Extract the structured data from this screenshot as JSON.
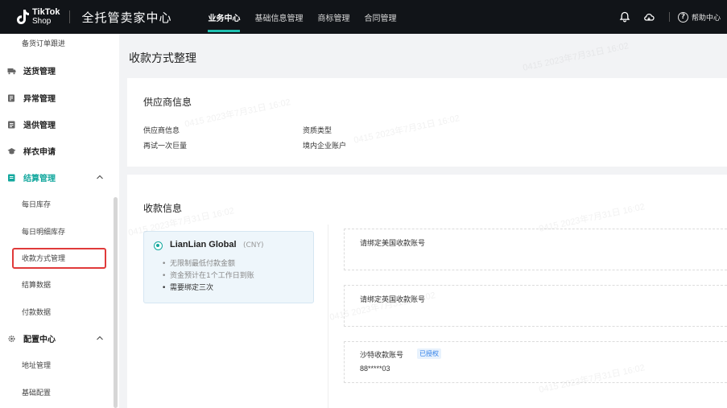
{
  "header": {
    "logo_line1": "TikTok",
    "logo_line2": "Shop",
    "app_title": "全托管卖家中心",
    "nav": [
      {
        "label": "业务中心",
        "active": true
      },
      {
        "label": "基础信息管理",
        "active": false
      },
      {
        "label": "商标管理",
        "active": false
      },
      {
        "label": "合同管理",
        "active": false
      }
    ],
    "help_label": "帮助中心",
    "help_icon": "?",
    "icons": [
      "bell-icon",
      "cloud-icon",
      "help-icon"
    ]
  },
  "sidebar": {
    "items": [
      {
        "label": "备货订单跟进",
        "type": "sub"
      },
      {
        "label": "送货管理",
        "type": "group",
        "icon": "truck-icon"
      },
      {
        "label": "异常管理",
        "type": "group",
        "icon": "warning-doc-icon"
      },
      {
        "label": "退供管理",
        "type": "group",
        "icon": "return-icon"
      },
      {
        "label": "样衣申请",
        "type": "group",
        "icon": "hat-icon"
      },
      {
        "label": "结算管理",
        "type": "group",
        "icon": "settlement-icon",
        "expanded": true
      },
      {
        "label": "每日库存",
        "type": "sub"
      },
      {
        "label": "每日明细库存",
        "type": "sub"
      },
      {
        "label": "收款方式管理",
        "type": "sub",
        "selected": true
      },
      {
        "label": "结算数据",
        "type": "sub"
      },
      {
        "label": "付款数据",
        "type": "sub"
      },
      {
        "label": "配置中心",
        "type": "group",
        "icon": "gear-icon",
        "expanded": true
      },
      {
        "label": "地址管理",
        "type": "sub"
      },
      {
        "label": "基础配置",
        "type": "sub"
      }
    ]
  },
  "main": {
    "page_title": "收款方式整理",
    "supplier_card": {
      "title": "供应商信息",
      "fields": [
        {
          "label": "供应商信息",
          "value": "再试一次巨量"
        },
        {
          "label": "资质类型",
          "value": "境内企业账户"
        }
      ]
    },
    "payment_card": {
      "title": "收款信息",
      "option": {
        "name": "LianLian Global",
        "currency": "(CNY)",
        "bullets": [
          "无限制最低付款金额",
          "资金预计在1个工作日到账",
          "需要绑定三次"
        ]
      },
      "accounts": [
        {
          "label": "请绑定美国收款账号",
          "badge": "",
          "value": ""
        },
        {
          "label": "请绑定英国收款账号",
          "badge": "",
          "value": ""
        },
        {
          "label": "沙特收款账号",
          "badge": "已授权",
          "value": "88*****03"
        }
      ]
    },
    "watermark_text": "0415 2023年7月31日 16:02"
  },
  "colors": {
    "accent": "#13a89e",
    "topbar": "#111418",
    "highlight": "#e03a3a",
    "badge_text": "#2f7fe8"
  }
}
